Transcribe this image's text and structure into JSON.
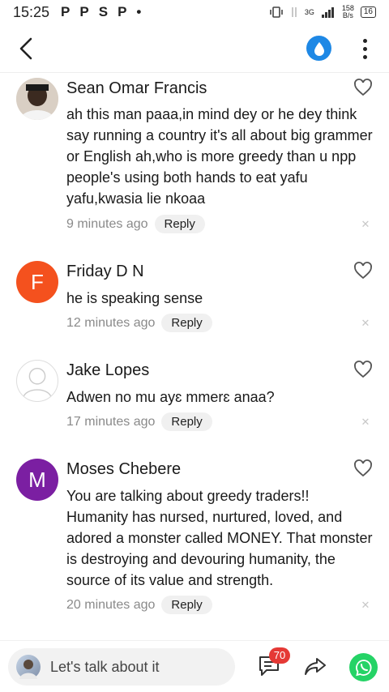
{
  "status_bar": {
    "time": "15:25",
    "app_icons": [
      "P",
      "P",
      "S",
      "P",
      "•"
    ],
    "network": "3G",
    "speed_value": "158",
    "speed_unit": "B/s",
    "battery": "16"
  },
  "top_bar": {
    "back_icon": "chevron-left-icon",
    "drop_icon": "water-drop-icon",
    "drop_color": "#1e88e5",
    "more_icon": "more-vertical-icon"
  },
  "comments": [
    {
      "author": "Sean Omar Francis",
      "avatar_type": "photo",
      "text": "ah this man paaa,in mind dey or he dey think say running a country it's all about big grammer or English ah,who is more greedy than u npp people's using both hands to eat yafu yafu,kwasia lie nkoaa",
      "time": "9 minutes ago",
      "reply_label": "Reply"
    },
    {
      "author": "Friday D N",
      "avatar_type": "letter",
      "avatar_letter": "F",
      "avatar_color": "#f4511e",
      "text": "he is speaking sense",
      "time": "12 minutes ago",
      "reply_label": "Reply"
    },
    {
      "author": "Jake Lopes",
      "avatar_type": "placeholder",
      "text": "Adwen no mu ayɛ mmerɛ anaa?",
      "time": "17 minutes ago",
      "reply_label": "Reply"
    },
    {
      "author": "Moses Chebere",
      "avatar_type": "letter",
      "avatar_letter": "M",
      "avatar_color": "#7b1fa2",
      "text": "You are talking about greedy traders!! Humanity has nursed, nurtured, loved, and adored a monster called MONEY. That monster is destroying and devouring humanity, the source of its value and strength.",
      "time": "20 minutes ago",
      "reply_label": "Reply"
    }
  ],
  "bottom_bar": {
    "placeholder": "Let's talk about it",
    "comment_count": "70",
    "badge_color": "#e53935",
    "whatsapp_color": "#25d366"
  }
}
